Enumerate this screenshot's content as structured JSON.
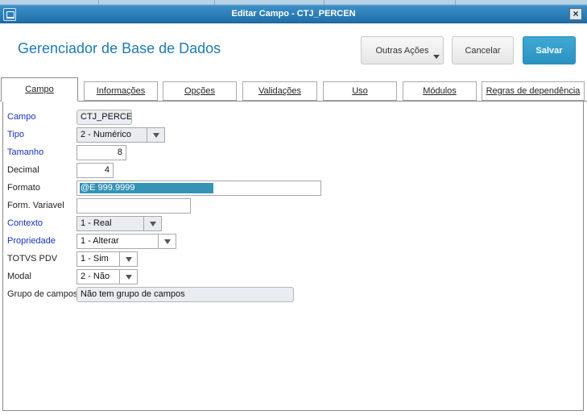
{
  "window": {
    "title": "Editar Campo - CTJ_PERCEN",
    "close_label": "×"
  },
  "header": {
    "app_title": "Gerenciador de Base de Dados",
    "buttons": {
      "outras": "Outras Ações",
      "cancel": "Cancelar",
      "save": "Salvar"
    }
  },
  "tabs": [
    "Campo",
    "Informações",
    "Opções",
    "Validações",
    "Uso",
    "Módulos",
    "Regras de dependência"
  ],
  "form": {
    "campo": {
      "label": "Campo",
      "value": "CTJ_PERCEN"
    },
    "tipo": {
      "label": "Tipo",
      "value": "2 - Numérico"
    },
    "tamanho": {
      "label": "Tamanho",
      "value": "8"
    },
    "decimal": {
      "label": "Decimal",
      "value": "4"
    },
    "formato": {
      "label": "Formato",
      "value": "@E 999.9999"
    },
    "form_variavel": {
      "label": "Form. Variavel",
      "value": ""
    },
    "contexto": {
      "label": "Contexto",
      "value": "1 - Real"
    },
    "propriedade": {
      "label": "Propriedade",
      "value": "1 - Alterar"
    },
    "totvs_pdv": {
      "label": "TOTVS PDV",
      "value": "1 - Sim"
    },
    "modal": {
      "label": "Modal",
      "value": "2 - Não"
    },
    "grupo": {
      "label": "Grupo de campos",
      "value": "Não tem grupo de campos"
    }
  },
  "colors": {
    "titlebar": "#2a7fbd",
    "accent": "#1f7ab5",
    "save": "#33a0cc",
    "required_label": "#1732c2",
    "selection": "#3593b5"
  }
}
